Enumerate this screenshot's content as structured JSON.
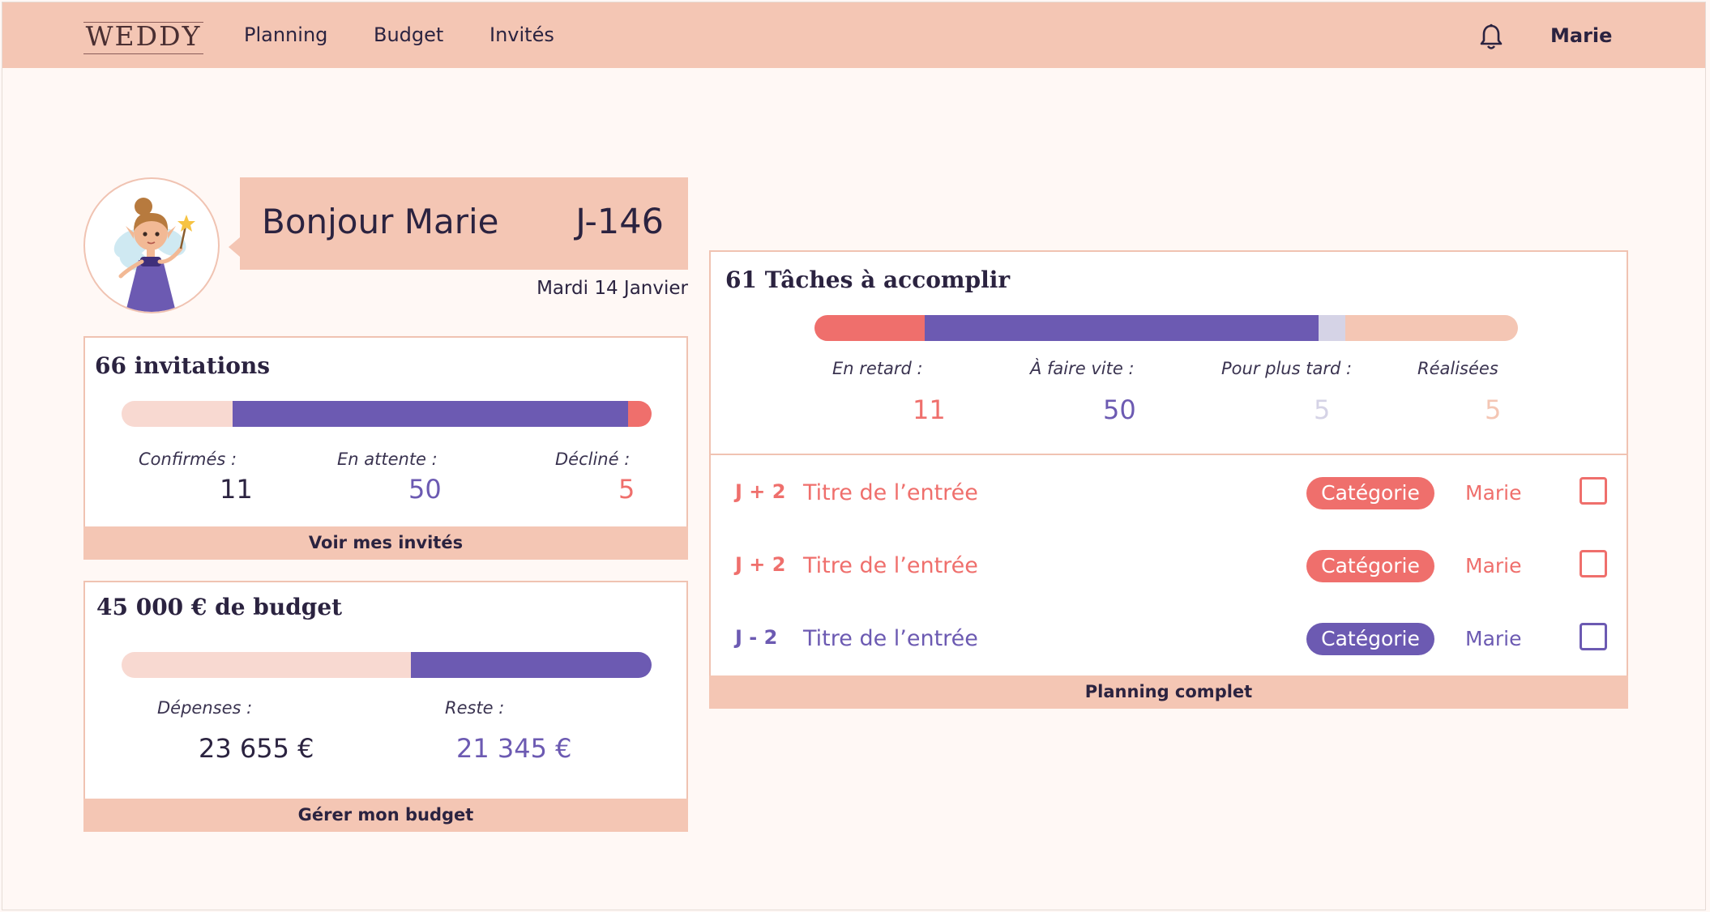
{
  "app": {
    "logo": "WEDDY",
    "nav": [
      "Planning",
      "Budget",
      "Invités"
    ],
    "user": "Marie",
    "icons": {
      "notifications": "bell-icon",
      "avatar": "fairy-illustration"
    }
  },
  "header": {
    "greeting": "Bonjour Marie",
    "countdown": "J-146",
    "date": "Mardi 14 Janvier"
  },
  "colors": {
    "peach": "#f4c6b4",
    "light_peach": "#f8d9d1",
    "purple": "#6c5ab2",
    "coral": "#ef6f6c",
    "lavender": "#d5d3e6",
    "dark_text": "#2b2340"
  },
  "invitations": {
    "title": "66 invitations",
    "labels": {
      "confirmed": "Confirmés :",
      "pending": "En attente :",
      "declined": "Décliné :"
    },
    "values": {
      "confirmed": "11",
      "pending": "50",
      "declined": "5"
    },
    "bar_fractions": [
      0.209,
      0.747,
      0.044
    ],
    "footer": "Voir mes invités"
  },
  "budget": {
    "title": "45 000 € de budget",
    "labels": {
      "spent": "Dépenses :",
      "remaining": "Reste :"
    },
    "values": {
      "spent": "23 655 €",
      "remaining": "21 345 €"
    },
    "bar_fractions": [
      0.546,
      0.454
    ],
    "footer": "Gérer mon budget"
  },
  "tasks": {
    "title": "61 Tâches à accomplir",
    "labels": {
      "late": "En retard :",
      "soon": "À faire vite :",
      "later": "Pour plus tard :",
      "done": "Réalisées"
    },
    "values": {
      "late": "11",
      "soon": "50",
      "later": "5",
      "done": "5"
    },
    "bar_fractions": [
      0.157,
      0.56,
      0.038,
      0.245
    ],
    "rows": [
      {
        "due": "J + 2",
        "title": "Titre de l’entrée",
        "category": "Catégorie",
        "user": "Marie",
        "tone": "red"
      },
      {
        "due": "J + 2",
        "title": "Titre de l’entrée",
        "category": "Catégorie",
        "user": "Marie",
        "tone": "red"
      },
      {
        "due": "J - 2",
        "title": "Titre de l’entrée",
        "category": "Catégorie",
        "user": "Marie",
        "tone": "purple"
      }
    ],
    "footer": "Planning complet"
  }
}
